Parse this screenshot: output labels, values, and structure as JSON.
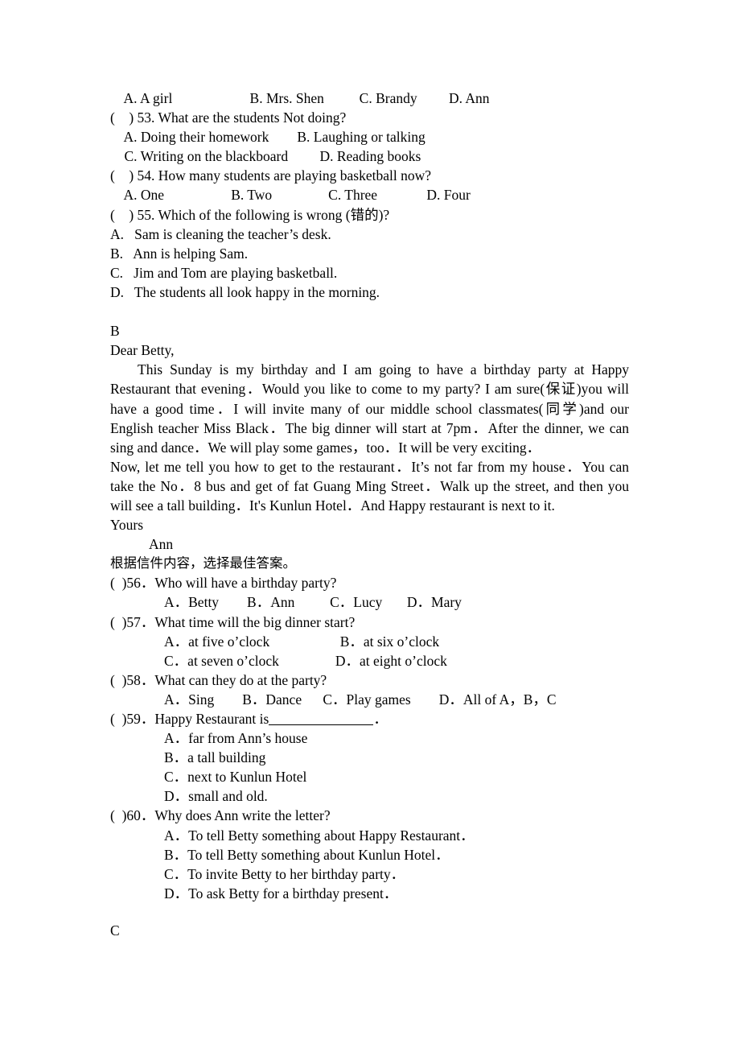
{
  "document": {
    "section_a_tail": {
      "q52_options_line": "    A. A girl                      B. Mrs. Shen          C. Brandy         D. Ann",
      "questions": [
        {
          "stem": "(    ) 53. What are the students Not doing?",
          "option_lines": [
            "    A. Doing their homework        B. Laughing or talking",
            "    C. Writing on the blackboard         D. Reading books"
          ]
        },
        {
          "stem": "(    ) 54. How many students are playing basketball now?",
          "option_lines": [
            "    A. One                   B. Two                C. Three              D. Four"
          ]
        },
        {
          "stem": "(    ) 55. Which of the following is wrong (错的)?",
          "option_lines": [
            "A.   Sam is cleaning the teacher’s desk.",
            "B.   Ann is helping Sam.",
            "C.   Jim and Tom are playing basketball.",
            "D.   The students all look happy in the morning."
          ]
        }
      ]
    },
    "section_b": {
      "label": "B",
      "salutation": "Dear Betty,",
      "body_paragraphs": [
        "This Sunday is my birthday and I am going to have a birthday party at Happy Restaurant that evening．Would you like to come to my party? I am sure(保证)you will have a good time．I will invite many of our middle school classmates(同学)and our English teacher Miss Black．The big dinner will start at 7pm．After the dinner, we can sing and dance．We will play some games，too．It will be very exciting．",
        "Now, let me tell you how to get to the restaurant．It’s not far from my house．You can take the No．8 bus and get of fat Guang Ming Street．Walk up the street, and then you will see a tall building．It's Kunlun Hotel．And Happy restaurant is next to it."
      ],
      "closing": "Yours",
      "signature": "Ann",
      "instruction": "根据信件内容，选择最佳答案。",
      "questions": [
        {
          "stem": "(  )56．Who will have a birthday party?",
          "option_lines": [
            "A．Betty        B．Ann          C．Lucy       D．Mary"
          ]
        },
        {
          "stem": "(  )57．What time will the big dinner start?",
          "option_lines": [
            "A．at five o’clock                    B．at six o’clock",
            "C．at seven o’clock                D．at eight o’clock"
          ]
        },
        {
          "stem": "(  )58．What can they do at the party?",
          "option_lines": [
            "A．Sing        B．Dance      C．Play games        D．All of A，B，C"
          ]
        },
        {
          "stem_prefix": "(  )59．Happy Restaurant is",
          "stem_suffix": "．",
          "has_blank": true,
          "option_lines": [
            "A．far from Ann’s house",
            "B．a tall building",
            "C．next to Kunlun Hotel",
            "D．small and old."
          ]
        },
        {
          "stem": "(  )60．Why does Ann write the letter?",
          "option_lines": [
            "A．To tell Betty something about Happy Restaurant．",
            "B．To tell Betty something about Kunlun Hotel．",
            "C．To invite Betty to her birthday party．",
            "D．To ask Betty for a birthday present．"
          ]
        }
      ]
    },
    "section_c": {
      "label": "C"
    }
  }
}
